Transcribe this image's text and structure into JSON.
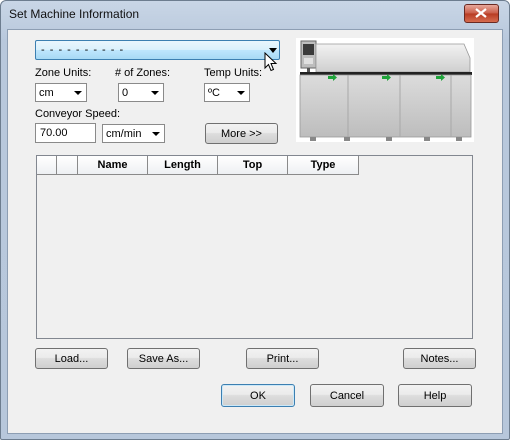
{
  "window": {
    "title": "Set Machine Information"
  },
  "machine": {
    "selected": "- - - - - - - - - -"
  },
  "zone_units": {
    "label": "Zone Units:",
    "value": "cm"
  },
  "zone_count": {
    "label": "# of Zones:",
    "value": "0"
  },
  "temp_units": {
    "label": "Temp Units:",
    "value": "ºC"
  },
  "conveyor": {
    "label": "Conveyor Speed:",
    "value": "70.00",
    "units": "cm/min"
  },
  "more_button": "More >>",
  "table": {
    "columns": [
      "",
      "",
      "Name",
      "Length",
      "Top",
      "Type"
    ],
    "rows": []
  },
  "buttons": {
    "load": "Load...",
    "save_as": "Save As...",
    "print": "Print...",
    "notes": "Notes...",
    "ok": "OK",
    "cancel": "Cancel",
    "help": "Help"
  },
  "icons": [
    "close-icon",
    "dropdown-arrow-icon",
    "oven-icon",
    "conveyor-arrow-icon",
    "mouse-cursor-icon"
  ],
  "colors": {
    "title_bar": "#b8c8dc",
    "close_button": "#c85a45",
    "combo_highlight": "#bee6fd",
    "oven_arrow": "#1fa43a",
    "ok_border": "#3c7fb1"
  }
}
